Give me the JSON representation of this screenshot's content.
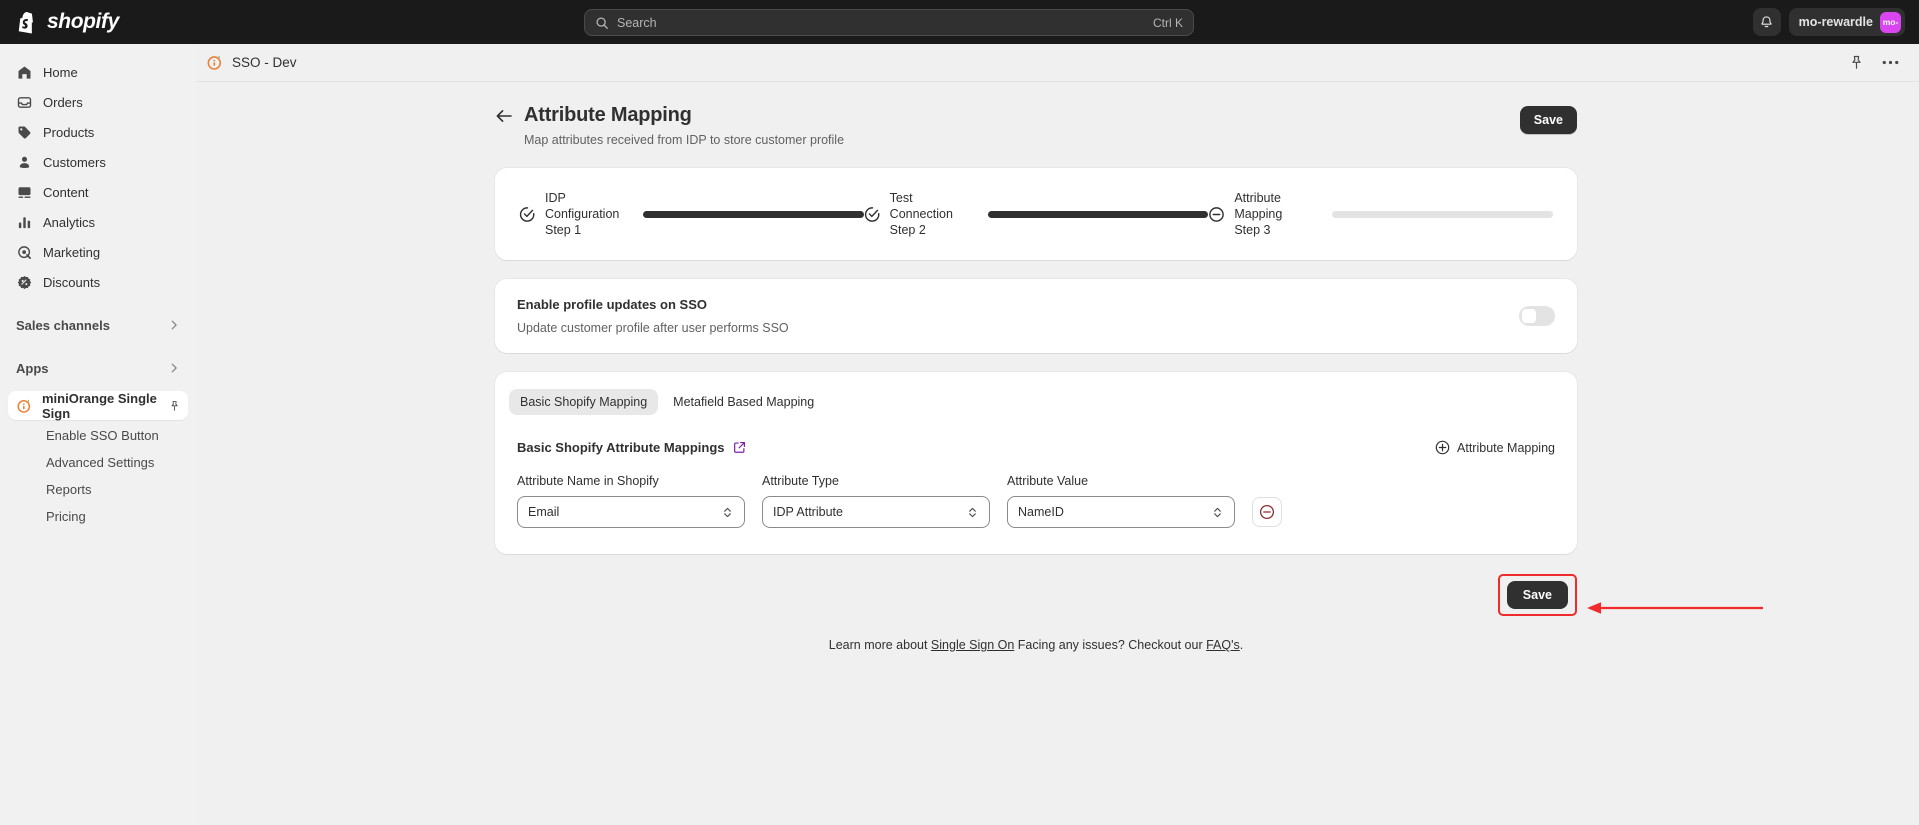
{
  "topbar": {
    "brand": "shopify",
    "brand_icon": "shopify-bag-icon",
    "search": {
      "placeholder": "Search",
      "shortcut": "Ctrl K",
      "icon": "search-icon"
    },
    "notifications_icon": "bell-icon",
    "user": {
      "name": "mo-rewardle",
      "avatar_initials": "mo-",
      "avatar_color": "#d946ef"
    }
  },
  "sidebar": {
    "items": [
      {
        "label": "Home",
        "icon": "home-icon"
      },
      {
        "label": "Orders",
        "icon": "orders-inbox-icon"
      },
      {
        "label": "Products",
        "icon": "product-tag-icon"
      },
      {
        "label": "Customers",
        "icon": "customer-person-icon"
      },
      {
        "label": "Content",
        "icon": "content-image-icon"
      },
      {
        "label": "Analytics",
        "icon": "analytics-bars-icon"
      },
      {
        "label": "Marketing",
        "icon": "marketing-target-icon"
      },
      {
        "label": "Discounts",
        "icon": "discount-badge-icon"
      }
    ],
    "groups": [
      {
        "label": "Sales channels",
        "icon": "chevron-right-icon"
      },
      {
        "label": "Apps",
        "icon": "chevron-right-icon"
      }
    ],
    "active_app": {
      "label": "miniOrange Single Sign",
      "icon": "miniorange-icon",
      "pin_icon": "pin-icon"
    },
    "app_subitems": [
      {
        "label": "Enable SSO Button"
      },
      {
        "label": "Advanced Settings"
      },
      {
        "label": "Reports"
      },
      {
        "label": "Pricing"
      }
    ]
  },
  "app_header": {
    "title": "SSO - Dev",
    "icon": "miniorange-icon",
    "pin_icon": "pin-icon",
    "more_icon": "more-horizontal-icon"
  },
  "page": {
    "back_icon": "arrow-left-icon",
    "title": "Attribute Mapping",
    "subtitle": "Map attributes received from IDP to store customer profile",
    "save_top_label": "Save"
  },
  "stepper": {
    "steps": [
      {
        "line1": "IDP",
        "line2": "Configuration",
        "line3": "Step 1",
        "icon": "check-circle-icon",
        "state": "complete"
      },
      {
        "line1": "Test",
        "line2": "Connection",
        "line3": "Step 2",
        "icon": "check-circle-icon",
        "state": "complete"
      },
      {
        "line1": "Attribute",
        "line2": "Mapping",
        "line3": "Step 3",
        "icon": "minus-circle-icon",
        "state": "pending"
      }
    ]
  },
  "profile_updates": {
    "title": "Enable profile updates on SSO",
    "description": "Update customer profile after user performs SSO",
    "toggle_state": "off"
  },
  "mapping": {
    "tabs": [
      {
        "label": "Basic Shopify Mapping",
        "active": true
      },
      {
        "label": "Metafield Based Mapping",
        "active": false
      }
    ],
    "section_title": "Basic Shopify Attribute Mappings",
    "section_link_icon": "external-link-icon",
    "add_button": {
      "label": "Attribute Mapping",
      "icon": "plus-circle-icon"
    },
    "columns": [
      {
        "label": "Attribute Name in Shopify"
      },
      {
        "label": "Attribute Type"
      },
      {
        "label": "Attribute Value"
      }
    ],
    "rows": [
      {
        "attribute_name": "Email",
        "attribute_type": "IDP Attribute",
        "attribute_value": "NameID",
        "remove_icon": "remove-circle-icon"
      }
    ],
    "save_bottom_label": "Save",
    "highlight_color": "#ef2b2b",
    "annotation_icon": "red-arrow-pointer"
  },
  "footer": {
    "text_before": "Learn more about ",
    "link1": "Single Sign On",
    "text_middle": " Facing any issues? Checkout our ",
    "link2": "FAQ's",
    "text_after": "."
  }
}
